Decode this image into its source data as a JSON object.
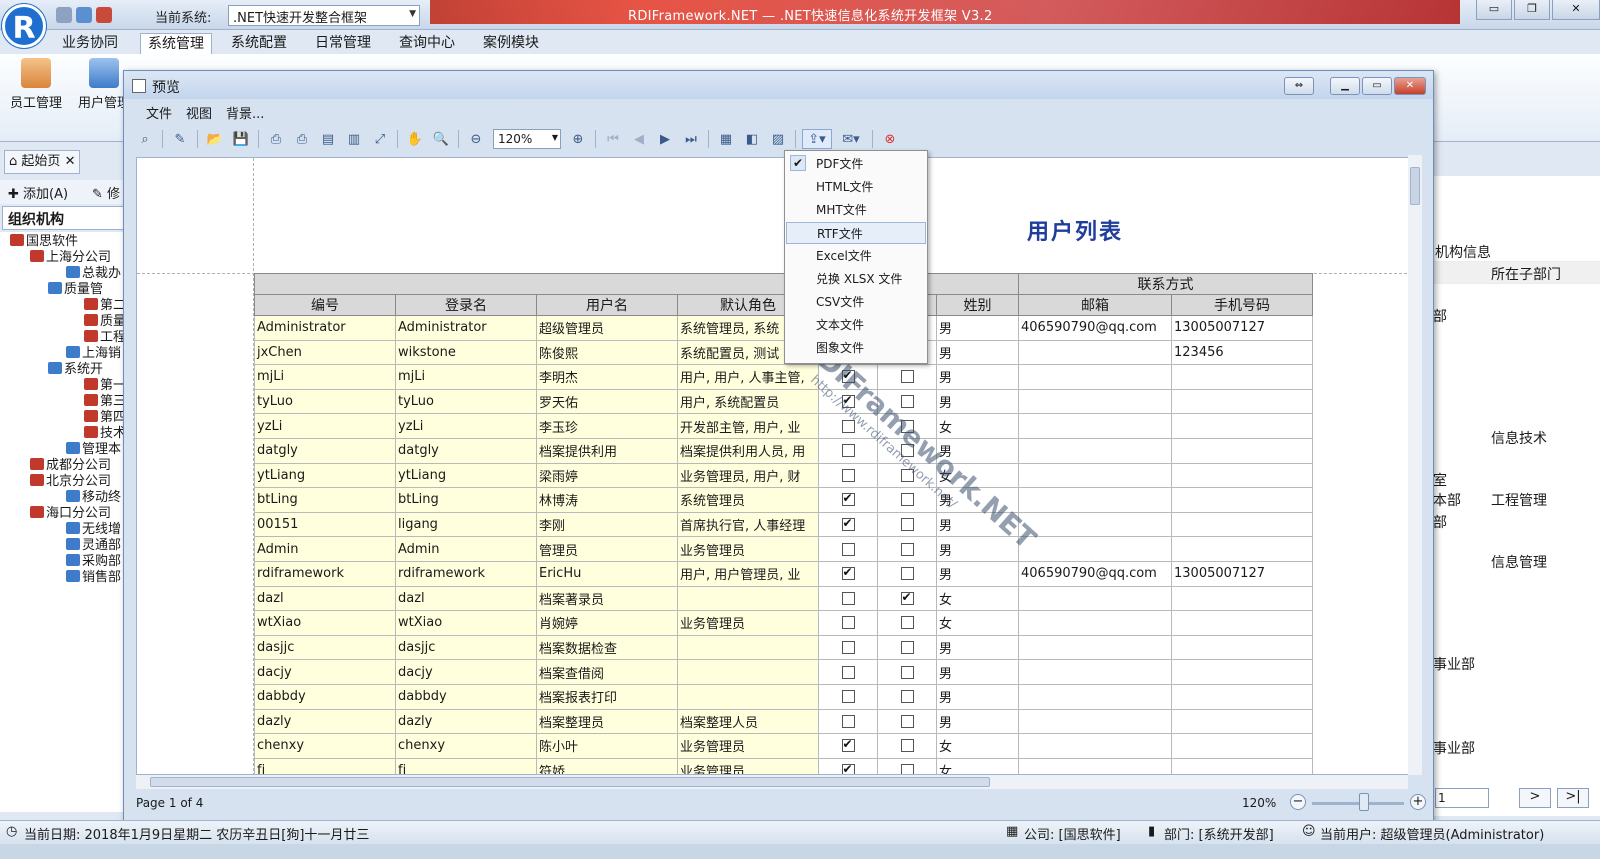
{
  "app": {
    "logo": "R",
    "current_system_label": "当前系统:",
    "current_system_value": ".NET快速开发整合框架",
    "title": "RDIFramework.NET — .NET快速信息化系统开发框架 V3.2"
  },
  "ribbon": {
    "tabs": [
      "业务协同",
      "系统管理",
      "系统配置",
      "日常管理",
      "查询中心",
      "案例模块"
    ],
    "active_tab": "系统管理",
    "buttons": [
      "员工管理",
      "用户管理"
    ]
  },
  "left": {
    "doc_tab_home": "起始页",
    "toolbar_add": "添加(A)",
    "toolbar_edit": "修",
    "org_title": "组织机构",
    "tree": [
      {
        "label": "国思软件"
      },
      {
        "label": "上海分公司"
      },
      {
        "label": "总裁办"
      },
      {
        "label": "质量管"
      },
      {
        "label": "第二"
      },
      {
        "label": "质量"
      },
      {
        "label": "工程"
      },
      {
        "label": "上海销"
      },
      {
        "label": "系统开"
      },
      {
        "label": "第一"
      },
      {
        "label": "第三"
      },
      {
        "label": "第四"
      },
      {
        "label": "技术"
      },
      {
        "label": "管理本"
      },
      {
        "label": "成都分公司"
      },
      {
        "label": "北京分公司"
      },
      {
        "label": "移动终"
      },
      {
        "label": "海口分公司"
      },
      {
        "label": "无线增"
      },
      {
        "label": "灵通部"
      },
      {
        "label": "采购部"
      },
      {
        "label": "销售部"
      }
    ]
  },
  "right": {
    "header1": "机构信息",
    "header2": "所在子部门",
    "cells": [
      "部",
      "信息技术",
      "室",
      "本部",
      "工程管理",
      "部",
      "信息管理",
      "事业部",
      "事业部"
    ],
    "page_value": "1"
  },
  "preview": {
    "title": "预览",
    "menu": [
      "文件",
      "视图",
      "背景..."
    ],
    "zoom": "120%",
    "page_info": "Page 1 of 4",
    "zoom_footer": "120%",
    "zoom_level_percent": 57
  },
  "export_menu": {
    "items": [
      "PDF文件",
      "HTML文件",
      "MHT文件",
      "RTF文件",
      "Excel文件",
      "兑换 XLSX 文件",
      "CSV文件",
      "文本文件",
      "图象文件"
    ],
    "checked_index": 0,
    "hover_index": 3
  },
  "report": {
    "title": "用户列表",
    "group_header": "联系方式",
    "columns": [
      "编号",
      "登录名",
      "用户名",
      "默认角色",
      "",
      "",
      "姓别",
      "邮箱",
      "手机号码"
    ],
    "rows": [
      {
        "id": "Administrator",
        "login": "Administrator",
        "name": "超级管理员",
        "role": "系统管理员, 系统",
        "c1": null,
        "c2": null,
        "sex": "男",
        "email": "406590790@qq.com",
        "phone": "13005007127"
      },
      {
        "id": "jxChen",
        "login": "wikstone",
        "name": "陈俊熙",
        "role": "系统配置员, 测试",
        "c1": null,
        "c2": null,
        "sex": "男",
        "email": "",
        "phone": "123456"
      },
      {
        "id": "mjLi",
        "login": "mjLi",
        "name": "李明杰",
        "role": "用户, 用户, 人事主管,",
        "c1": true,
        "c2": false,
        "sex": "男",
        "email": "",
        "phone": ""
      },
      {
        "id": "tyLuo",
        "login": "tyLuo",
        "name": "罗天佑",
        "role": "用户, 系统配置员",
        "c1": true,
        "c2": false,
        "sex": "男",
        "email": "",
        "phone": ""
      },
      {
        "id": "yzLi",
        "login": "yzLi",
        "name": "李玉珍",
        "role": "开发部主管, 用户, 业",
        "c1": false,
        "c2": false,
        "sex": "女",
        "email": "",
        "phone": ""
      },
      {
        "id": "datgly",
        "login": "datgly",
        "name": "档案提供利用",
        "role": "档案提供利用人员, 用",
        "c1": false,
        "c2": false,
        "sex": "男",
        "email": "",
        "phone": ""
      },
      {
        "id": "ytLiang",
        "login": "ytLiang",
        "name": "梁雨婷",
        "role": "业务管理员, 用户, 财",
        "c1": false,
        "c2": false,
        "sex": "女",
        "email": "",
        "phone": ""
      },
      {
        "id": "btLing",
        "login": "btLing",
        "name": "林博涛",
        "role": "系统管理员",
        "c1": true,
        "c2": false,
        "sex": "男",
        "email": "",
        "phone": ""
      },
      {
        "id": "00151",
        "login": "ligang",
        "name": "李刚",
        "role": "首席执行官, 人事经理",
        "c1": true,
        "c2": false,
        "sex": "男",
        "email": "",
        "phone": ""
      },
      {
        "id": "Admin",
        "login": "Admin",
        "name": "管理员",
        "role": "业务管理员",
        "c1": false,
        "c2": false,
        "sex": "男",
        "email": "",
        "phone": ""
      },
      {
        "id": "rdiframework",
        "login": "rdiframework",
        "name": "EricHu",
        "role": "用户, 用户管理员, 业",
        "c1": true,
        "c2": false,
        "sex": "男",
        "email": "406590790@qq.com",
        "phone": "13005007127"
      },
      {
        "id": "dazl",
        "login": "dazl",
        "name": "档案著录员",
        "role": "",
        "c1": false,
        "c2": true,
        "sex": "女",
        "email": "",
        "phone": ""
      },
      {
        "id": "wtXiao",
        "login": "wtXiao",
        "name": "肖婉婷",
        "role": "业务管理员",
        "c1": false,
        "c2": false,
        "sex": "女",
        "email": "",
        "phone": ""
      },
      {
        "id": "dasjjc",
        "login": "dasjjc",
        "name": "档案数据检查",
        "role": "",
        "c1": false,
        "c2": false,
        "sex": "男",
        "email": "",
        "phone": ""
      },
      {
        "id": "dacjy",
        "login": "dacjy",
        "name": "档案查借阅",
        "role": "",
        "c1": false,
        "c2": false,
        "sex": "男",
        "email": "",
        "phone": ""
      },
      {
        "id": "dabbdy",
        "login": "dabbdy",
        "name": "档案报表打印",
        "role": "",
        "c1": false,
        "c2": false,
        "sex": "男",
        "email": "",
        "phone": ""
      },
      {
        "id": "dazly",
        "login": "dazly",
        "name": "档案整理员",
        "role": "档案整理人员",
        "c1": false,
        "c2": false,
        "sex": "男",
        "email": "",
        "phone": ""
      },
      {
        "id": "chenxy",
        "login": "chenxy",
        "name": "陈小叶",
        "role": "业务管理员",
        "c1": true,
        "c2": false,
        "sex": "女",
        "email": "",
        "phone": ""
      },
      {
        "id": "fj",
        "login": "fj",
        "name": "符娇",
        "role": "业务管理员",
        "c1": true,
        "c2": false,
        "sex": "女",
        "email": "",
        "phone": ""
      }
    ]
  },
  "watermark": {
    "main": "RDIFramework.NET",
    "sub": "http://www.rdiframework.net/"
  },
  "status": {
    "date": "当前日期: 2018年1月9日星期二 农历辛丑日[狗]十一月廿三",
    "company": "公司: [国思软件]",
    "dept": "部门: [系统开发部]",
    "user": "当前用户: 超级管理员(Administrator)"
  },
  "colors": {
    "accent": "#1f3d9a",
    "title_band": "#d03a2f",
    "cell_yellow": "#ffffdd"
  }
}
